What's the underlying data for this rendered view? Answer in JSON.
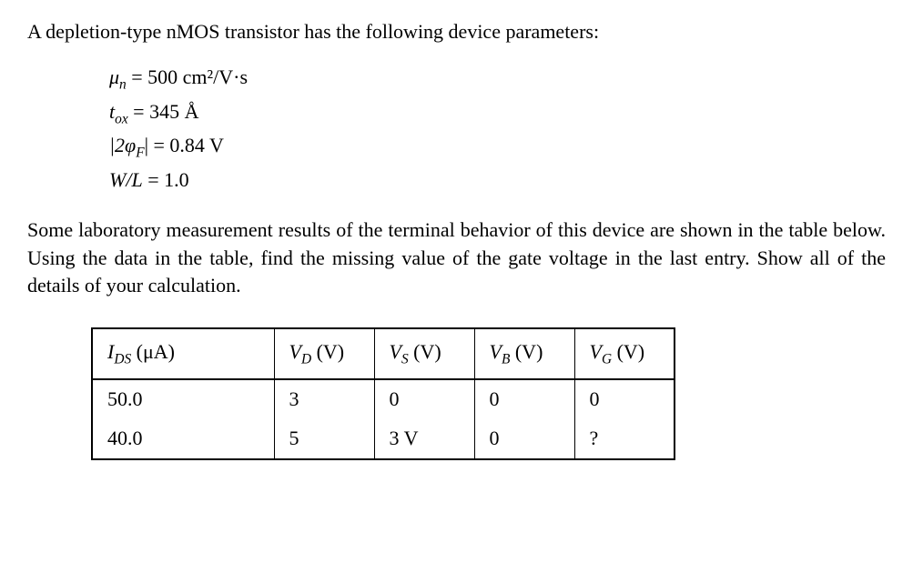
{
  "intro": "A depletion-type nMOS transistor has the following device parameters:",
  "params": {
    "mu_label_pre": "μ",
    "mu_sub": "n",
    "mu_value": " = 500 cm²/V·s",
    "tox_label_pre": "t",
    "tox_sub": "ox",
    "tox_value": " = 345 Å",
    "phi_label_pre": "|2φ",
    "phi_sub": "F",
    "phi_value": "| = 0.84 V",
    "wl_label": "W/L",
    "wl_value": " = 1.0"
  },
  "description": "Some laboratory measurement results of the terminal behavior of this device are shown in the table below. Using the data in the table, find the missing value of the gate voltage in the last entry. Show all of the details of your calculation.",
  "table": {
    "headers": {
      "ids": {
        "pre": "I",
        "sub": "DS",
        "post": " (μA)"
      },
      "vd": {
        "pre": "V",
        "sub": "D",
        "post": " (V)"
      },
      "vs": {
        "pre": "V",
        "sub": "S",
        "post": " (V)"
      },
      "vb": {
        "pre": "V",
        "sub": "B",
        "post": " (V)"
      },
      "vg": {
        "pre": "V",
        "sub": "G",
        "post": " (V)"
      }
    },
    "rows": [
      {
        "ids": "50.0",
        "vd": "3",
        "vs": "0",
        "vb": "0",
        "vg": "0"
      },
      {
        "ids": "40.0",
        "vd": "5",
        "vs": "3 V",
        "vb": "0",
        "vg": "?"
      }
    ]
  }
}
